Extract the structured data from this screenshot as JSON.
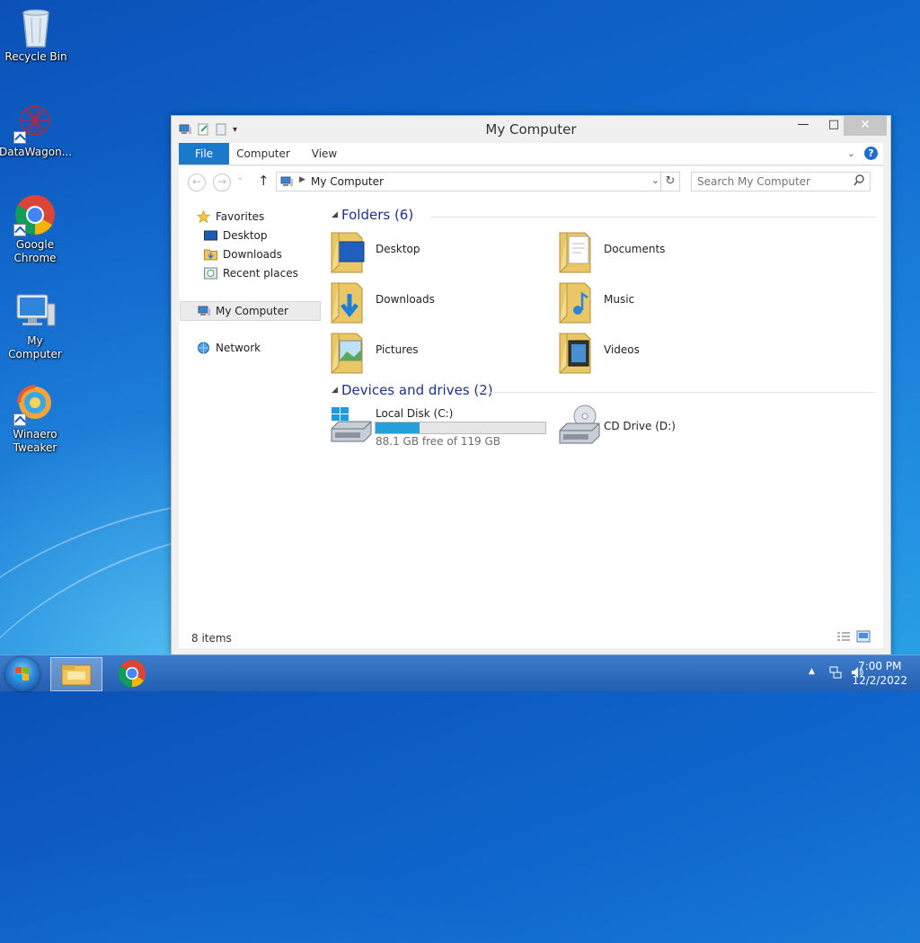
{
  "desktop": {
    "icons": [
      {
        "label": "Recycle Bin",
        "icon": "recycle-bin-icon"
      },
      {
        "label": "DataWagon...",
        "icon": "datawagon-icon"
      },
      {
        "label": "Google Chrome",
        "icon": "chrome-icon"
      },
      {
        "label": "My Computer",
        "icon": "computer-icon"
      },
      {
        "label": "Winaero Tweaker",
        "icon": "winaero-tweaker-icon"
      }
    ]
  },
  "window": {
    "title": "My Computer",
    "controls": {
      "minimize": "—",
      "maximize": "□",
      "close": "✕"
    },
    "ribbon": {
      "tabs": [
        "File",
        "Computer",
        "View"
      ]
    },
    "address": {
      "path": "My Computer",
      "dropdown": "⌄",
      "refresh": "↻"
    },
    "nav": {
      "back": "←",
      "forward": "→",
      "recent": "⌄",
      "up": "↑"
    },
    "search": {
      "placeholder": "Search My Computer"
    },
    "sidebar": {
      "favorites": "Favorites",
      "favorite_items": [
        "Desktop",
        "Downloads",
        "Recent places"
      ],
      "my_computer": "My Computer",
      "network": "Network"
    },
    "groups": {
      "folders_header": "Folders (6)",
      "folders": [
        "Desktop",
        "Documents",
        "Downloads",
        "Music",
        "Pictures",
        "Videos"
      ],
      "devices_header": "Devices and drives (2)",
      "local_disk": {
        "name": "Local Disk (C:)",
        "free_text": "88.1 GB free of 119 GB",
        "used_fraction": 0.26
      },
      "cd_drive": {
        "name": "CD Drive (D:)"
      }
    },
    "status": {
      "items": "8 items"
    }
  },
  "taskbar": {
    "time": "7:00 PM",
    "date": "12/2/2022"
  },
  "colors": {
    "accent": "#1979ca",
    "group_header": "#1e3287",
    "drive_fill": "#26a0da"
  }
}
